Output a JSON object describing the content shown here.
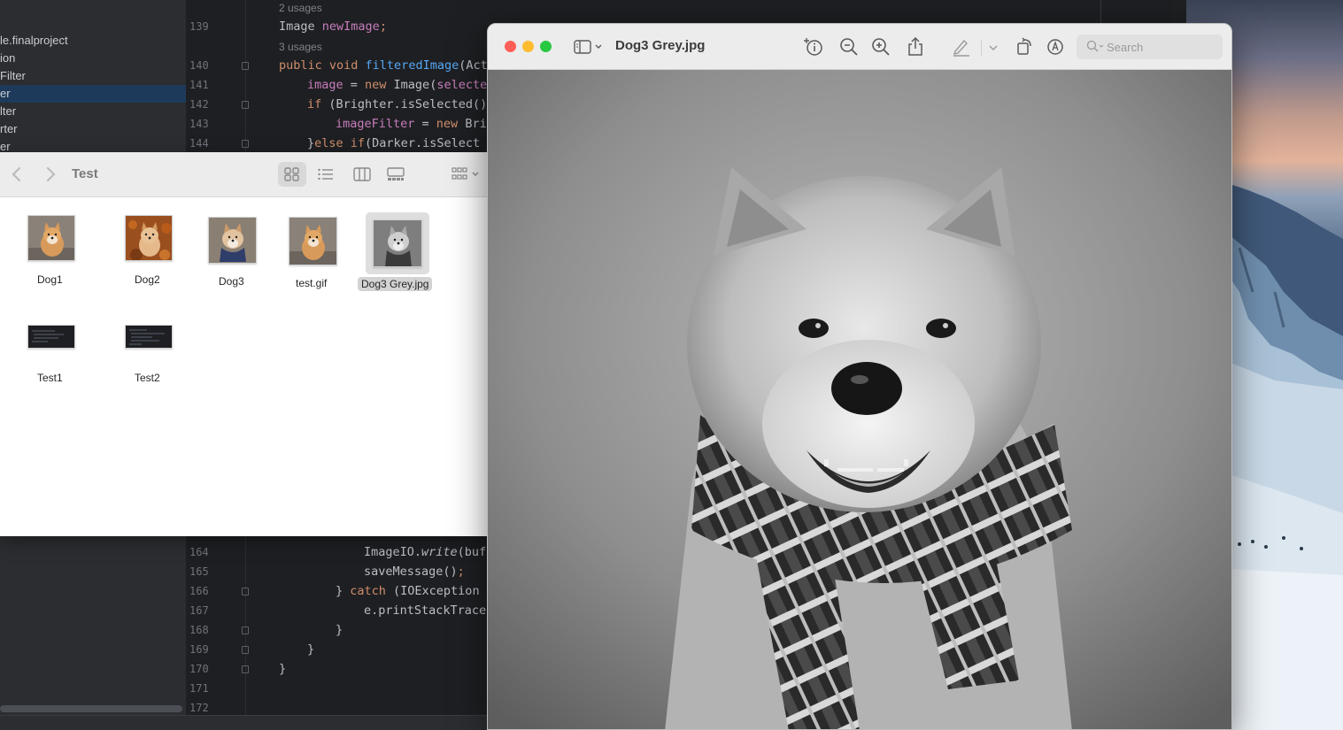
{
  "ide": {
    "project_items": [
      "le.finalproject",
      "ion",
      "Filter",
      "er",
      "lter",
      "rter",
      "er"
    ],
    "lines": [
      {
        "num": "",
        "usages": "2 usages"
      },
      {
        "num": "139",
        "code": "Image newImage;"
      },
      {
        "num": "",
        "usages": "3 usages"
      },
      {
        "num": "140",
        "code": "public void filteredImage(Acti"
      },
      {
        "num": "141",
        "code": "image = new Image(selecte"
      },
      {
        "num": "142",
        "code": "if (Brighter.isSelected()"
      },
      {
        "num": "143",
        "code": "imageFilter = new Brig"
      },
      {
        "num": "144",
        "code": "}else if(Darker.isSelect"
      },
      {
        "num": "164",
        "code": "ImageIO.write(buf"
      },
      {
        "num": "165",
        "code": "saveMessage();"
      },
      {
        "num": "166",
        "code": "} catch (IOException e"
      },
      {
        "num": "167",
        "code": "e.printStackTrace"
      },
      {
        "num": "168",
        "code": "}"
      },
      {
        "num": "169",
        "code": "}"
      },
      {
        "num": "170",
        "code": "}"
      },
      {
        "num": "171",
        "code": ""
      },
      {
        "num": "172",
        "code": ""
      }
    ]
  },
  "finder": {
    "title": "Test",
    "back_icon": "chevron-left-icon",
    "forward_icon": "chevron-right-icon",
    "views": [
      "icon-view",
      "list-view",
      "column-view",
      "gallery-view",
      "group-by"
    ],
    "items": [
      {
        "name": "Dog1",
        "kind": "photo-color"
      },
      {
        "name": "Dog2",
        "kind": "photo-autumn"
      },
      {
        "name": "Dog3",
        "kind": "photo-scarf"
      },
      {
        "name": "test.gif",
        "kind": "photo-color"
      },
      {
        "name": "Dog3 Grey.jpg",
        "kind": "photo-grey",
        "selected": true
      },
      {
        "name": "Test1",
        "kind": "screenshot"
      },
      {
        "name": "Test2",
        "kind": "screenshot"
      }
    ]
  },
  "preview": {
    "title": "Dog3 Grey.jpg",
    "search_placeholder": "Search",
    "toolbar_icons": [
      "sidebar-icon",
      "info-icon",
      "zoom-out-icon",
      "zoom-in-icon",
      "share-icon",
      "markup-pen-icon",
      "rotate-icon",
      "annotate-icon"
    ],
    "colors": {
      "close": "#ff5f57",
      "minimize": "#febc2e",
      "zoom": "#28c840"
    }
  }
}
